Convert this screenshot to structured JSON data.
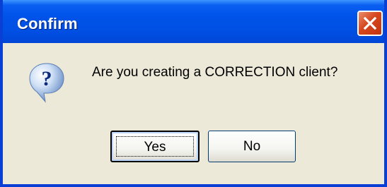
{
  "window": {
    "title": "Confirm",
    "message": "Are you creating a CORRECTION client?"
  },
  "buttons": {
    "yes_label": "Yes",
    "no_label": "No"
  },
  "icons": {
    "dialog_icon": "question-icon",
    "close_icon": "close-icon"
  },
  "colors": {
    "titlebar": "#0052e8",
    "window_bg": "#ece9d8",
    "close_button": "#d6471e"
  }
}
